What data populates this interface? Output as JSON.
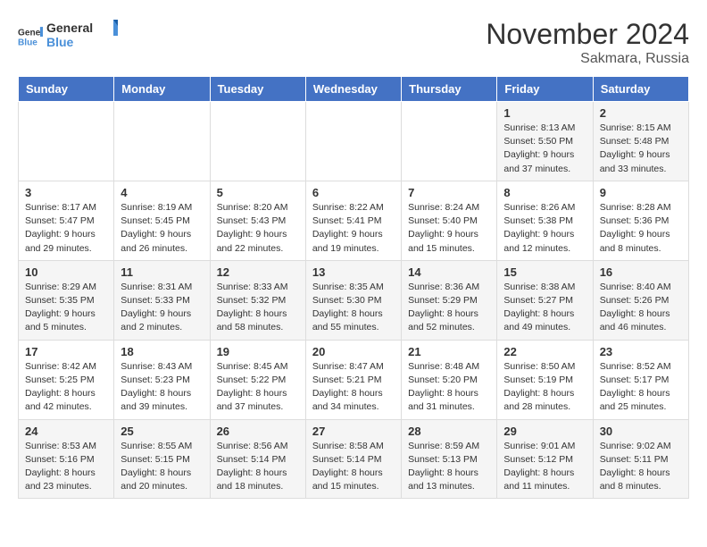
{
  "header": {
    "logo_general": "General",
    "logo_blue": "Blue",
    "month_title": "November 2024",
    "location": "Sakmara, Russia"
  },
  "weekdays": [
    "Sunday",
    "Monday",
    "Tuesday",
    "Wednesday",
    "Thursday",
    "Friday",
    "Saturday"
  ],
  "weeks": [
    [
      {
        "day": "",
        "info": ""
      },
      {
        "day": "",
        "info": ""
      },
      {
        "day": "",
        "info": ""
      },
      {
        "day": "",
        "info": ""
      },
      {
        "day": "",
        "info": ""
      },
      {
        "day": "1",
        "info": "Sunrise: 8:13 AM\nSunset: 5:50 PM\nDaylight: 9 hours and 37 minutes."
      },
      {
        "day": "2",
        "info": "Sunrise: 8:15 AM\nSunset: 5:48 PM\nDaylight: 9 hours and 33 minutes."
      }
    ],
    [
      {
        "day": "3",
        "info": "Sunrise: 8:17 AM\nSunset: 5:47 PM\nDaylight: 9 hours and 29 minutes."
      },
      {
        "day": "4",
        "info": "Sunrise: 8:19 AM\nSunset: 5:45 PM\nDaylight: 9 hours and 26 minutes."
      },
      {
        "day": "5",
        "info": "Sunrise: 8:20 AM\nSunset: 5:43 PM\nDaylight: 9 hours and 22 minutes."
      },
      {
        "day": "6",
        "info": "Sunrise: 8:22 AM\nSunset: 5:41 PM\nDaylight: 9 hours and 19 minutes."
      },
      {
        "day": "7",
        "info": "Sunrise: 8:24 AM\nSunset: 5:40 PM\nDaylight: 9 hours and 15 minutes."
      },
      {
        "day": "8",
        "info": "Sunrise: 8:26 AM\nSunset: 5:38 PM\nDaylight: 9 hours and 12 minutes."
      },
      {
        "day": "9",
        "info": "Sunrise: 8:28 AM\nSunset: 5:36 PM\nDaylight: 9 hours and 8 minutes."
      }
    ],
    [
      {
        "day": "10",
        "info": "Sunrise: 8:29 AM\nSunset: 5:35 PM\nDaylight: 9 hours and 5 minutes."
      },
      {
        "day": "11",
        "info": "Sunrise: 8:31 AM\nSunset: 5:33 PM\nDaylight: 9 hours and 2 minutes."
      },
      {
        "day": "12",
        "info": "Sunrise: 8:33 AM\nSunset: 5:32 PM\nDaylight: 8 hours and 58 minutes."
      },
      {
        "day": "13",
        "info": "Sunrise: 8:35 AM\nSunset: 5:30 PM\nDaylight: 8 hours and 55 minutes."
      },
      {
        "day": "14",
        "info": "Sunrise: 8:36 AM\nSunset: 5:29 PM\nDaylight: 8 hours and 52 minutes."
      },
      {
        "day": "15",
        "info": "Sunrise: 8:38 AM\nSunset: 5:27 PM\nDaylight: 8 hours and 49 minutes."
      },
      {
        "day": "16",
        "info": "Sunrise: 8:40 AM\nSunset: 5:26 PM\nDaylight: 8 hours and 46 minutes."
      }
    ],
    [
      {
        "day": "17",
        "info": "Sunrise: 8:42 AM\nSunset: 5:25 PM\nDaylight: 8 hours and 42 minutes."
      },
      {
        "day": "18",
        "info": "Sunrise: 8:43 AM\nSunset: 5:23 PM\nDaylight: 8 hours and 39 minutes."
      },
      {
        "day": "19",
        "info": "Sunrise: 8:45 AM\nSunset: 5:22 PM\nDaylight: 8 hours and 37 minutes."
      },
      {
        "day": "20",
        "info": "Sunrise: 8:47 AM\nSunset: 5:21 PM\nDaylight: 8 hours and 34 minutes."
      },
      {
        "day": "21",
        "info": "Sunrise: 8:48 AM\nSunset: 5:20 PM\nDaylight: 8 hours and 31 minutes."
      },
      {
        "day": "22",
        "info": "Sunrise: 8:50 AM\nSunset: 5:19 PM\nDaylight: 8 hours and 28 minutes."
      },
      {
        "day": "23",
        "info": "Sunrise: 8:52 AM\nSunset: 5:17 PM\nDaylight: 8 hours and 25 minutes."
      }
    ],
    [
      {
        "day": "24",
        "info": "Sunrise: 8:53 AM\nSunset: 5:16 PM\nDaylight: 8 hours and 23 minutes."
      },
      {
        "day": "25",
        "info": "Sunrise: 8:55 AM\nSunset: 5:15 PM\nDaylight: 8 hours and 20 minutes."
      },
      {
        "day": "26",
        "info": "Sunrise: 8:56 AM\nSunset: 5:14 PM\nDaylight: 8 hours and 18 minutes."
      },
      {
        "day": "27",
        "info": "Sunrise: 8:58 AM\nSunset: 5:14 PM\nDaylight: 8 hours and 15 minutes."
      },
      {
        "day": "28",
        "info": "Sunrise: 8:59 AM\nSunset: 5:13 PM\nDaylight: 8 hours and 13 minutes."
      },
      {
        "day": "29",
        "info": "Sunrise: 9:01 AM\nSunset: 5:12 PM\nDaylight: 8 hours and 11 minutes."
      },
      {
        "day": "30",
        "info": "Sunrise: 9:02 AM\nSunset: 5:11 PM\nDaylight: 8 hours and 8 minutes."
      }
    ]
  ]
}
